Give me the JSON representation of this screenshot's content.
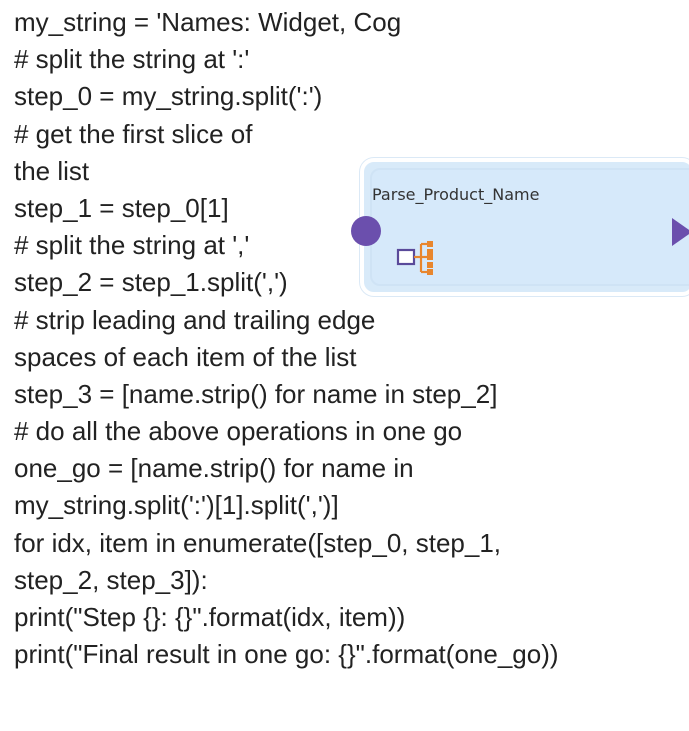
{
  "code_lines": [
    "my_string = 'Names: Widget, Cog",
    "# split the string at ':'",
    "step_0 = my_string.split(':')",
    "# get the first slice of",
    "the list",
    "step_1 = step_0[1]",
    "# split the string at ','",
    "step_2 = step_1.split(',')",
    "# strip leading and trailing edge",
    "spaces of each item of the list",
    "step_3 = [name.strip() for name in step_2]",
    "# do all the above operations in one go",
    "one_go = [name.strip() for name in",
    "my_string.split(':')[1].split(',')]",
    "for idx, item in enumerate([step_0, step_1,",
    "step_2, step_3]):",
    "print(\"Step {}: {}\".format(idx, item))",
    "print(\"Final result in one go: {}\".format(one_go))"
  ],
  "node": {
    "title": "Parse_Product_Name",
    "icon": "hierarchy-parse-icon",
    "accent_color": "#6b4fad",
    "icon_color": "#e8862d",
    "fill_color": "#d6e9fa"
  }
}
